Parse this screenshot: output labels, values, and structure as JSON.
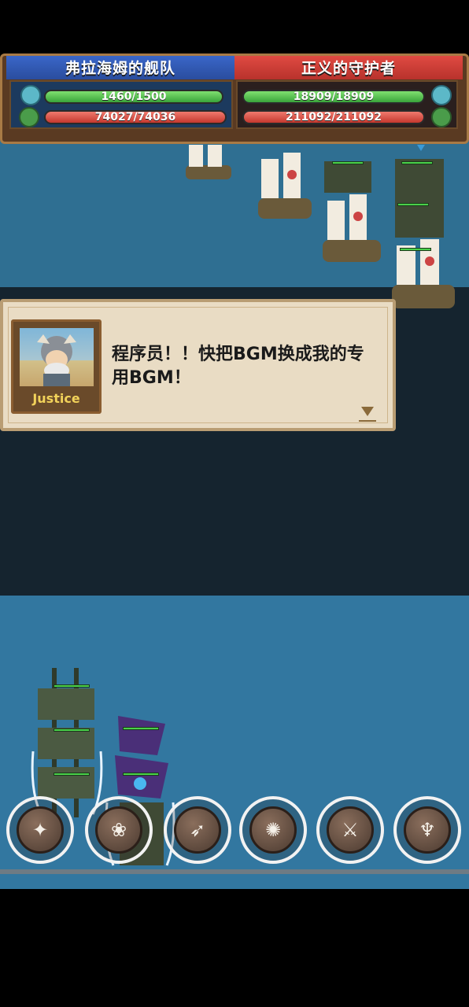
{
  "hud": {
    "left_team": {
      "name": "弗拉海姆的舰队",
      "crew_hp": "1460/1500",
      "crew_hp_fraction": 0.973,
      "ship_hp": "74027/74036",
      "ship_hp_fraction": 0.9999
    },
    "right_team": {
      "name": "正义的守护者",
      "crew_hp": "18909/18909",
      "crew_hp_fraction": 1.0,
      "ship_hp": "211092/211092",
      "ship_hp_fraction": 1.0
    }
  },
  "dialog": {
    "speaker": "Justice",
    "text": "程序员！！快把BGM换成我的专用BGM！"
  },
  "skills": [
    {
      "icon": "sparkle-skill-icon"
    },
    {
      "icon": "kraken-skill-icon"
    },
    {
      "icon": "shark-skill-icon"
    },
    {
      "icon": "beast-skill-icon"
    },
    {
      "icon": "warrior-skill-icon"
    },
    {
      "icon": "mermaid-skill-icon"
    }
  ],
  "colors": {
    "sea": "#3277a0",
    "left_team_banner": "#3a66c8",
    "right_team_banner": "#e04a42",
    "crew_bar": "#3aa43a",
    "ship_bar": "#c4382e"
  }
}
